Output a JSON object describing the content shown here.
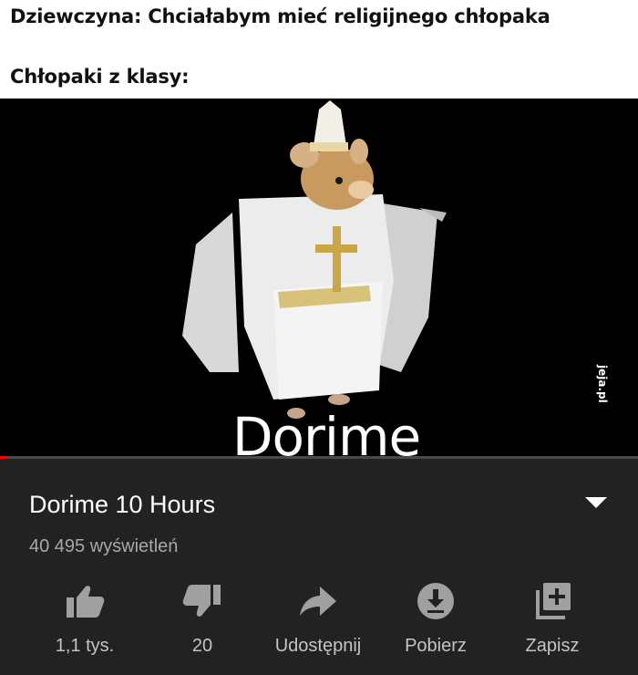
{
  "meme": {
    "line1": "Dziewczyna: Chciałabym mieć religijnego chłopaka",
    "line2": "Chłopaki z klasy:"
  },
  "video": {
    "overlay_text": "Dorime",
    "watermark": "jeja.pl",
    "progress": 0.01,
    "progress_color": "#ff0000"
  },
  "info": {
    "title": "Dorime 10 Hours",
    "views": "40 495 wyświetleń",
    "expand_icon": "chevron-down-icon"
  },
  "actions": [
    {
      "icon": "thumbs-up-icon",
      "label": "1,1 tys."
    },
    {
      "icon": "thumbs-down-icon",
      "label": "20"
    },
    {
      "icon": "share-icon",
      "label": "Udostępnij"
    },
    {
      "icon": "download-icon",
      "label": "Pobierz"
    },
    {
      "icon": "save-playlist-icon",
      "label": "Zapisz"
    }
  ],
  "colors": {
    "panel_bg": "#222222",
    "icon": "#a0a0a0",
    "text_secondary": "#a8a8a8"
  }
}
